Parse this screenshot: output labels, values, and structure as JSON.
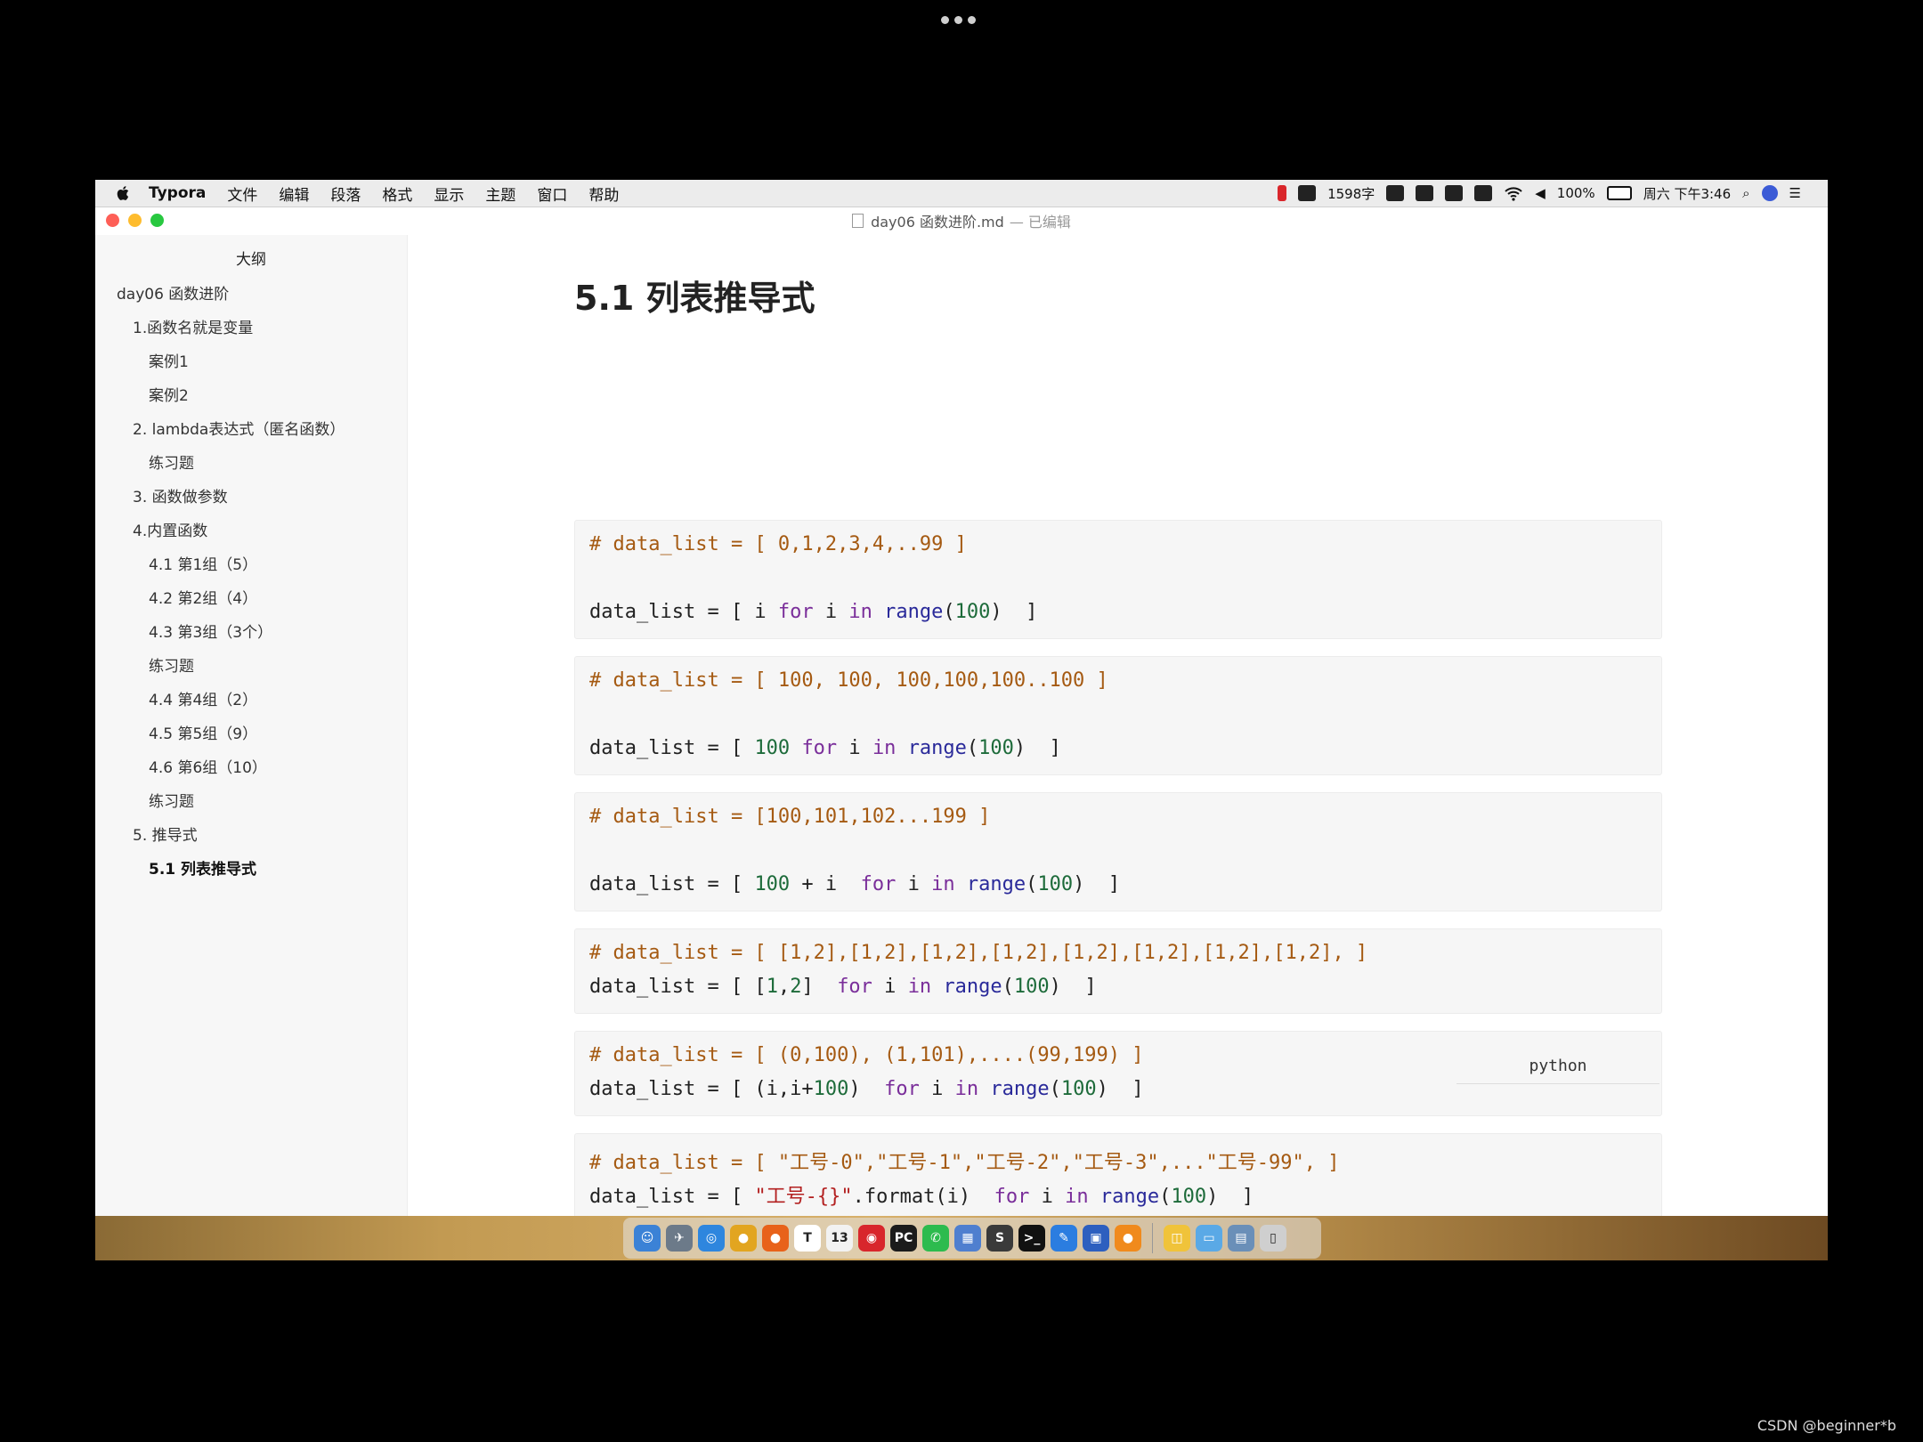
{
  "menubar": {
    "app_name": "Typora",
    "menus": [
      "文件",
      "编辑",
      "段落",
      "格式",
      "显示",
      "主题",
      "窗口",
      "帮助"
    ],
    "word_count": "1598字",
    "battery": "100%",
    "clock": "周六 下午3:46"
  },
  "window": {
    "title": "day06 函数进阶.md",
    "title_suffix": "— 已编辑"
  },
  "sidebar": {
    "heading": "大纲",
    "items": [
      {
        "label": "day06 函数进阶",
        "level": 1
      },
      {
        "label": "1.函数名就是变量",
        "level": 2
      },
      {
        "label": "案例1",
        "level": 3
      },
      {
        "label": "案例2",
        "level": 3
      },
      {
        "label": "2. lambda表达式（匿名函数）",
        "level": 2
      },
      {
        "label": "练习题",
        "level": 3
      },
      {
        "label": "3. 函数做参数",
        "level": 2
      },
      {
        "label": "4.内置函数",
        "level": 2
      },
      {
        "label": "4.1 第1组（5）",
        "level": 3
      },
      {
        "label": "4.2 第2组（4）",
        "level": 3
      },
      {
        "label": "4.3 第3组（3个）",
        "level": 3
      },
      {
        "label": "练习题",
        "level": 3
      },
      {
        "label": "4.4 第4组（2）",
        "level": 3
      },
      {
        "label": "4.5 第5组（9）",
        "level": 3
      },
      {
        "label": "4.6 第6组（10）",
        "level": 3
      },
      {
        "label": "练习题",
        "level": 3
      },
      {
        "label": "5. 推导式",
        "level": 2
      },
      {
        "label": "5.1 列表推导式",
        "level": 3,
        "active": true
      }
    ]
  },
  "editor": {
    "heading": "5.1 列表推导式",
    "code_language": "python",
    "blocks": [
      {
        "comment": "# data_list = [ 0,1,2,3,4,..99 ]",
        "code": {
          "a": "data_list = [ i ",
          "for": "for",
          "b": " i ",
          "in": "in",
          "c": " ",
          "range": "range",
          "d": "(",
          "num": "100",
          "e": ")  ]"
        }
      },
      {
        "comment": "# data_list = [ 100, 100, 100,100,100..100 ]",
        "code": {
          "a": "data_list = [ ",
          "lead": "100",
          "b": " ",
          "for": "for",
          "c": " i ",
          "in": "in",
          "d": " ",
          "range": "range",
          "e": "(",
          "num": "100",
          "f": ")  ]"
        }
      },
      {
        "comment": "# data_list = [100,101,102...199 ]",
        "code": {
          "a": "data_list = [ ",
          "lead": "100",
          "b": " + i  ",
          "for": "for",
          "c": " i ",
          "in": "in",
          "d": " ",
          "range": "range",
          "e": "(",
          "num": "100",
          "f": ")  ]"
        }
      },
      {
        "comment": "# data_list = [ [1,2],[1,2],[1,2],[1,2],[1,2],[1,2],[1,2],[1,2], ]",
        "code": {
          "a": "data_list = [ [",
          "n1": "1",
          "b": ",",
          "n2": "2",
          "c": "]  ",
          "for": "for",
          "d": " i ",
          "in": "in",
          "e": " ",
          "range": "range",
          "f": "(",
          "num": "100",
          "g": ")  ]"
        }
      },
      {
        "comment": "# data_list = [ (0,100), (1,101),....(99,199) ]",
        "code": {
          "a": "data_list = [ (i,i+",
          "lead": "100",
          "b": ")  ",
          "for": "for",
          "c": " i ",
          "in": "in",
          "d": " ",
          "range": "range",
          "e": "(",
          "num": "100",
          "f": ")  ]"
        }
      },
      {
        "comment": "# data_list = [ \"工号-0\",\"工号-1\",\"工号-2\",\"工号-3\",...\"工号-99\", ]",
        "code": {
          "a": "data_list = [ ",
          "str": "\"工号-{}\"",
          "b": ".format(i)  ",
          "for": "for",
          "c": " i ",
          "in": "in",
          "d": " ",
          "range": "range",
          "e": "(",
          "num": "100",
          "f": ")  ]"
        }
      }
    ]
  },
  "dock": {
    "apps": [
      {
        "name": "finder",
        "color": "#3b82d6",
        "glyph": "☺"
      },
      {
        "name": "launchpad",
        "color": "#6c7a89",
        "glyph": "✈"
      },
      {
        "name": "safari",
        "color": "#2e86de",
        "glyph": "◎"
      },
      {
        "name": "chrome",
        "color": "#e2a520",
        "glyph": "●"
      },
      {
        "name": "firefox",
        "color": "#e8621a",
        "glyph": "●"
      },
      {
        "name": "typora",
        "color": "#ffffff",
        "glyph": "T"
      },
      {
        "name": "calendar",
        "color": "#f2f2f2",
        "glyph": "13"
      },
      {
        "name": "netease-music",
        "color": "#d8262c",
        "glyph": "◉"
      },
      {
        "name": "pycharm",
        "color": "#1b1b1b",
        "glyph": "PC"
      },
      {
        "name": "wechat",
        "color": "#2dbb4e",
        "glyph": "✆"
      },
      {
        "name": "keynote",
        "color": "#4f7fcf",
        "glyph": "▦"
      },
      {
        "name": "sublime-text",
        "color": "#3a3a3a",
        "glyph": "S"
      },
      {
        "name": "terminal",
        "color": "#111111",
        "glyph": ">_"
      },
      {
        "name": "xcode",
        "color": "#2b7de0",
        "glyph": "✎"
      },
      {
        "name": "screen-flow",
        "color": "#2d5fbf",
        "glyph": "▣"
      },
      {
        "name": "recorder",
        "color": "#f08a1c",
        "glyph": "●"
      },
      {
        "name": "preview",
        "color": "#f0c33a",
        "glyph": "◫"
      },
      {
        "name": "folder",
        "color": "#5aa9e6",
        "glyph": "▭"
      },
      {
        "name": "downloads",
        "color": "#6a8fb8",
        "glyph": "▤"
      },
      {
        "name": "trash",
        "color": "#cfcfcf",
        "glyph": "▯"
      }
    ]
  },
  "watermark": "CSDN @beginner*b"
}
